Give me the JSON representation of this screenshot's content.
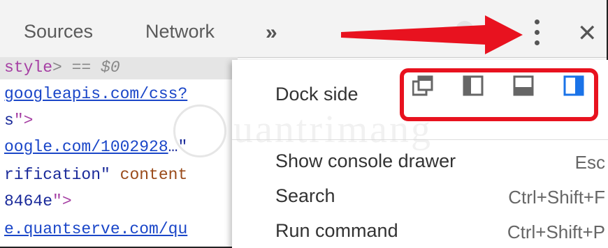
{
  "topbar": {
    "tabs": [
      {
        "label": "Sources"
      },
      {
        "label": "Network"
      }
    ],
    "overflow_label": "»",
    "menu_icon": "kebab-menu-icon",
    "close_label": "✕"
  },
  "code_lines": [
    {
      "a": "style",
      "b": "> == ",
      "c": "$0"
    },
    {
      "a": "googleapis.com/css?"
    },
    {
      "a": "s",
      "b": "\">"
    },
    {
      "a": "oogle.com/1002928",
      "b": "…\""
    },
    {
      "a": "rification",
      "b": "\" ",
      "c": "content"
    },
    {
      "a": "8464e",
      "b": "\">"
    },
    {
      "a": "e.quantserve.com/qu"
    }
  ],
  "menu": {
    "dock_side_label": "Dock side",
    "dock_options": [
      {
        "name": "undock-icon",
        "selected": false
      },
      {
        "name": "dock-left-icon",
        "selected": false
      },
      {
        "name": "dock-bottom-icon",
        "selected": false
      },
      {
        "name": "dock-right-icon",
        "selected": true
      }
    ],
    "items": [
      {
        "label": "Show console drawer",
        "shortcut": "Esc"
      },
      {
        "label": "Search",
        "shortcut": "Ctrl+Shift+F"
      },
      {
        "label": "Run command",
        "shortcut": "Ctrl+Shift+P"
      }
    ]
  },
  "watermark": "uantrimang",
  "colors": {
    "highlight_red": "#e8121f",
    "selected_blue": "#1a73e8",
    "icon_gray": "#666666"
  }
}
